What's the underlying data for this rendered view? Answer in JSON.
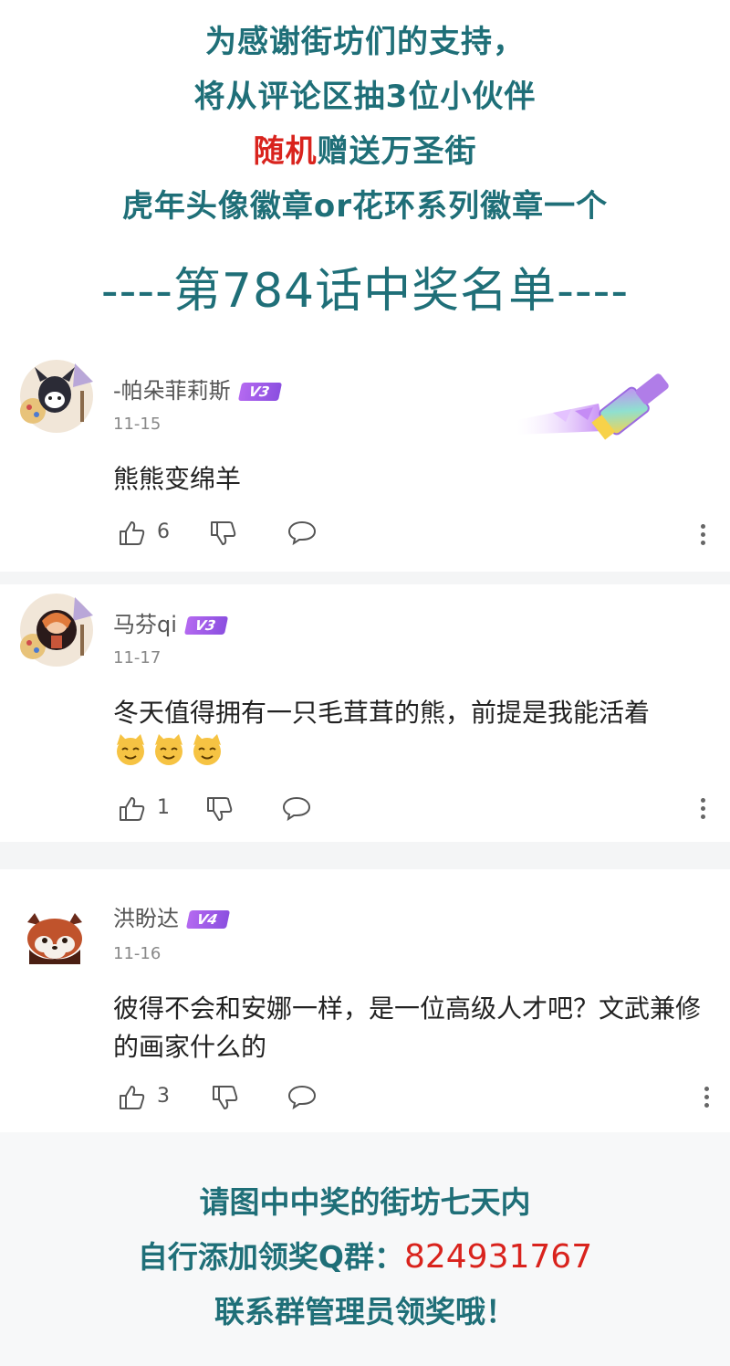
{
  "header": {
    "line1": "为感谢街坊们的支持，",
    "line2": "将从评论区抽3位小伙伴",
    "line3_red": "随机",
    "line3_rest": "赠送万圣街",
    "line4": "虎年头像徽章or花环系列徽章一个",
    "winners_title": "----第784话中奖名单----"
  },
  "comments": [
    {
      "user": "-帕朵菲莉斯",
      "level": "V3",
      "date": "11-15",
      "text": "熊熊变绵羊",
      "likes": "6"
    },
    {
      "user": "马芬qi",
      "level": "V3",
      "date": "11-17",
      "text": "冬天值得拥有一只毛茸茸的熊，前提是我能活着",
      "likes": "1"
    },
    {
      "user": "洪盼达",
      "level": "V4",
      "date": "11-16",
      "text": "彼得不会和安娜一样，是一位高级人才吧？文武兼修的画家什么的",
      "likes": "3"
    }
  ],
  "footer": {
    "line1": "请图中中奖的街坊七天内",
    "line2_prefix": "自行添加领奖Q群：",
    "line2_qq": "824931767",
    "line3": "联系群管理员领奖哦！"
  },
  "colors": {
    "teal": "#1f6f78",
    "red": "#d9231d",
    "badge": "#9b59e8"
  },
  "icons": [
    "like-icon",
    "dislike-icon",
    "reply-icon",
    "more-icon",
    "brush-decoration",
    "cat-emoji"
  ]
}
